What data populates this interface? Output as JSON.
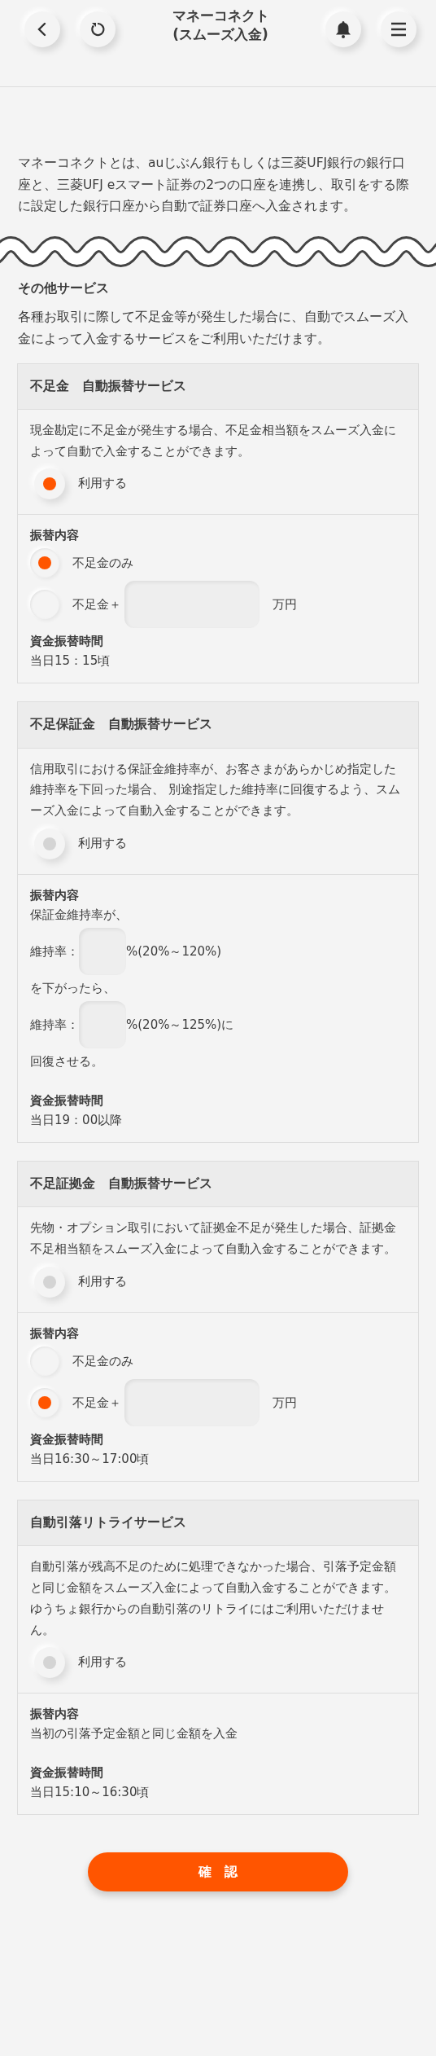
{
  "header": {
    "title_lines": [
      "マネーコネクト",
      "(スムーズ入金)"
    ]
  },
  "intro": "マネーコネクトとは、auじぶん銀行もしくは三菱UFJ銀行の銀行口座と、三菱UFJ eスマート証券の2つの口座を連携し、取引をする際に設定した銀行口座から自動で証券口座へ入金されます。",
  "other": {
    "heading": "その他サービス",
    "description": "各種お取引に際して不足金等が発生した場合に、自動でスムーズ入金によって入金するサービスをご利用いただけます。"
  },
  "services": [
    {
      "title": "不足金　自動振替サービス",
      "description": "現金勘定に不足金が発生する場合、不足金相当額をスムーズ入金によって自動で入金することができます。",
      "use": {
        "label": "利用する",
        "on": true
      },
      "detail": {
        "heading": "振替内容",
        "items": [
          {
            "kind": "radio",
            "label": "不足金のみ",
            "selected": true
          },
          {
            "kind": "radio-amount",
            "label": "不足金＋",
            "unit": "万円",
            "selected": false
          }
        ]
      },
      "time": {
        "heading": "資金振替時間",
        "value": "当日15：15頃"
      }
    },
    {
      "title": "不足保証金　自動振替サービス",
      "description": "信用取引における保証金維持率が、お客さまがあらかじめ指定した維持率を下回った場合、 別途指定した維持率に回復するよう、スムーズ入金によって自動入金することができます。",
      "use": {
        "label": "利用する",
        "on": false
      },
      "detail": {
        "heading": "振替内容",
        "items": [
          {
            "kind": "text",
            "text": "保証金維持率が、"
          },
          {
            "kind": "rate",
            "label": "維持率：",
            "suffix": "%(20%～120%)"
          },
          {
            "kind": "text",
            "text": "を下がったら、"
          },
          {
            "kind": "rate",
            "label": "維持率：",
            "suffix": "%(20%～125%)に"
          },
          {
            "kind": "text",
            "text": "回復させる。"
          }
        ]
      },
      "time": {
        "heading": "資金振替時間",
        "value": "当日19：00以降"
      }
    },
    {
      "title": "不足証拠金　自動振替サービス",
      "description": "先物・オプション取引において証拠金不足が発生した場合、証拠金不足相当額をスムーズ入金によって自動入金することができます。",
      "use": {
        "label": "利用する",
        "on": false
      },
      "detail": {
        "heading": "振替内容",
        "items": [
          {
            "kind": "radio",
            "label": "不足金のみ",
            "selected": false
          },
          {
            "kind": "radio-amount",
            "label": "不足金＋",
            "unit": "万円",
            "selected": true
          }
        ]
      },
      "time": {
        "heading": "資金振替時間",
        "value": "当日16:30～17:00頃"
      }
    },
    {
      "title": "自動引落リトライサービス",
      "description": "自動引落が残高不足のために処理できなかった場合、引落予定金額と同じ金額をスムーズ入金によって自動入金することができます。ゆうちょ銀行からの自動引落のリトライにはご利用いただけません。",
      "use": {
        "label": "利用する",
        "on": false
      },
      "detail": {
        "heading": "振替内容",
        "items": [
          {
            "kind": "text",
            "text": "当初の引落予定金額と同じ金額を入金"
          }
        ]
      },
      "time": {
        "heading": "資金振替時間",
        "value": "当日15:10～16:30頃"
      }
    }
  ],
  "confirm_button": "確　認"
}
